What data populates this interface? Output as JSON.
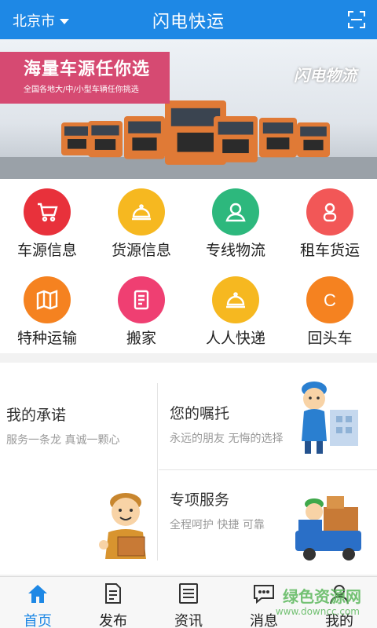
{
  "header": {
    "city": "北京市",
    "title": "闪电快运",
    "scan_icon": "scan-icon"
  },
  "banner": {
    "headline": "海量车源任你选",
    "subline": "全国各地大/中/小型车辆任你挑选",
    "brand": "闪电物流"
  },
  "grid": {
    "items": [
      {
        "label": "车源信息",
        "icon": "cart-icon",
        "color": "#e8313b"
      },
      {
        "label": "货源信息",
        "icon": "bell-icon",
        "color": "#f6b820"
      },
      {
        "label": "专线物流",
        "icon": "person-icon",
        "color": "#2db87d"
      },
      {
        "label": "租车货运",
        "icon": "user-icon",
        "color": "#f25757"
      },
      {
        "label": "特种运输",
        "icon": "map-icon",
        "color": "#f58220"
      },
      {
        "label": "搬家",
        "icon": "document-icon",
        "color": "#ef3f72"
      },
      {
        "label": "人人快递",
        "icon": "bell-icon",
        "color": "#f6b820"
      },
      {
        "label": "回头车",
        "icon": "c-letter-icon",
        "color": "#f58220"
      }
    ]
  },
  "panel": {
    "promise": {
      "title": "我的承诺",
      "subtitle": "服务一条龙  真诚一颗心"
    },
    "trust": {
      "title": "您的嘱托",
      "subtitle": "永远的朋友 无悔的选择"
    },
    "special": {
      "title": "专项服务",
      "subtitle": "全程呵护 快捷 可靠"
    }
  },
  "nav": {
    "tabs": [
      {
        "label": "首页",
        "icon": "home-icon",
        "active": true
      },
      {
        "label": "发布",
        "icon": "publish-icon",
        "active": false
      },
      {
        "label": "资讯",
        "icon": "news-icon",
        "active": false
      },
      {
        "label": "消息",
        "icon": "message-icon",
        "active": false
      },
      {
        "label": "我的",
        "icon": "profile-icon",
        "active": false
      }
    ]
  },
  "watermark": {
    "text": "绿色资源网",
    "url_text": "www.downcc.com"
  },
  "colors": {
    "primary": "#1e88e5",
    "ribbon": "#d64a72",
    "truck": "#e07a36"
  }
}
